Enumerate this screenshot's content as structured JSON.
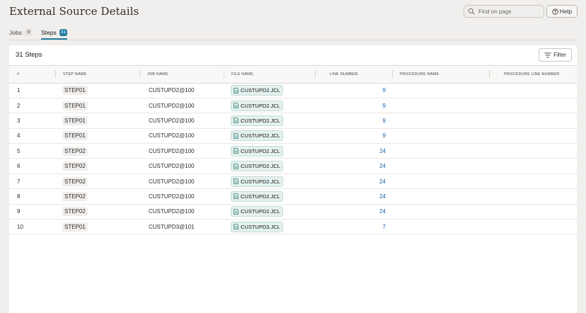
{
  "page": {
    "title": "External Source Details",
    "search_placeholder": "Find on page",
    "help_label": "Help"
  },
  "tabs": [
    {
      "label": "Jobs",
      "count": "9",
      "active": false
    },
    {
      "label": "Steps",
      "count": "31",
      "active": true
    }
  ],
  "panel": {
    "title": "31 Steps",
    "filter_label": "Filter"
  },
  "table": {
    "headers": [
      "#",
      "STEP NAME",
      "JOB NAME",
      "FILE NAME",
      "LINE NUMBER",
      "PROCEDURE NAME",
      "PROCEDURE LINE NUMBER"
    ],
    "rows": [
      {
        "num": "1",
        "step": "STEP01",
        "job": "CUSTUPD2@100",
        "file": "CUSTUPD2.JCL",
        "line": "9",
        "proc": "",
        "proc_line": ""
      },
      {
        "num": "2",
        "step": "STEP01",
        "job": "CUSTUPD2@100",
        "file": "CUSTUPD2.JCL",
        "line": "9",
        "proc": "",
        "proc_line": ""
      },
      {
        "num": "3",
        "step": "STEP01",
        "job": "CUSTUPD2@100",
        "file": "CUSTUPD2.JCL",
        "line": "9",
        "proc": "",
        "proc_line": ""
      },
      {
        "num": "4",
        "step": "STEP01",
        "job": "CUSTUPD2@100",
        "file": "CUSTUPD2.JCL",
        "line": "9",
        "proc": "",
        "proc_line": ""
      },
      {
        "num": "5",
        "step": "STEP02",
        "job": "CUSTUPD2@100",
        "file": "CUSTUPD2.JCL",
        "line": "24",
        "proc": "",
        "proc_line": ""
      },
      {
        "num": "6",
        "step": "STEP02",
        "job": "CUSTUPD2@100",
        "file": "CUSTUPD2.JCL",
        "line": "24",
        "proc": "",
        "proc_line": ""
      },
      {
        "num": "7",
        "step": "STEP02",
        "job": "CUSTUPD2@100",
        "file": "CUSTUPD2.JCL",
        "line": "24",
        "proc": "",
        "proc_line": ""
      },
      {
        "num": "8",
        "step": "STEP02",
        "job": "CUSTUPD2@100",
        "file": "CUSTUPD2.JCL",
        "line": "24",
        "proc": "",
        "proc_line": ""
      },
      {
        "num": "9",
        "step": "STEP02",
        "job": "CUSTUPD2@100",
        "file": "CUSTUPD2.JCL",
        "line": "24",
        "proc": "",
        "proc_line": ""
      },
      {
        "num": "10",
        "step": "STEP01",
        "job": "CUSTUPD3@101",
        "file": "CUSTUPD3.JCL",
        "line": "7",
        "proc": "",
        "proc_line": ""
      }
    ]
  },
  "colors": {
    "accent": "#227e9e",
    "link": "#1b5fa8",
    "page_bg": "#f1efed",
    "file_chip_bg": "#e4f1ef"
  },
  "icons": {
    "search": "search-icon",
    "help": "help-circle-icon",
    "filter": "filter-icon",
    "file": "file-icon"
  }
}
